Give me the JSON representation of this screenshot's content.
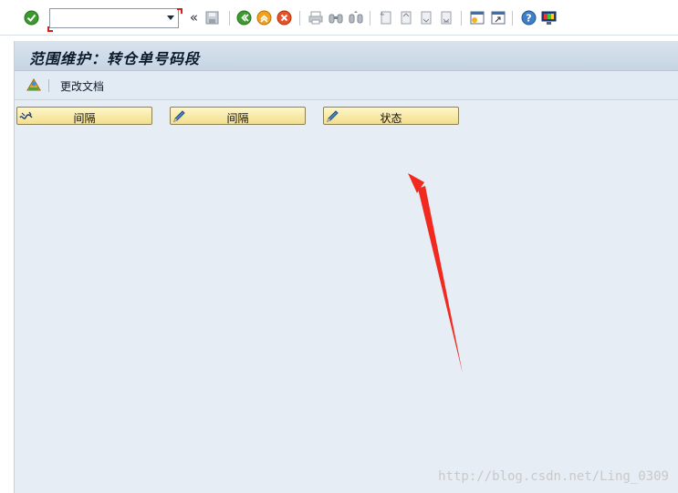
{
  "toolbar": {
    "command_field": {
      "value": "",
      "placeholder": ""
    },
    "icons": [
      "enter-icon",
      "back-double-icon",
      "save-icon",
      "back-icon",
      "exit-icon",
      "cancel-icon",
      "print-icon",
      "find-icon",
      "find-next-icon",
      "first-page-icon",
      "previous-page-icon",
      "next-page-icon",
      "last-page-icon",
      "create-session-icon",
      "shortcut-icon",
      "help-icon",
      "customize-layout-icon"
    ]
  },
  "screen": {
    "title": "范围维护：转仓单号码段"
  },
  "app_toolbar": {
    "change_docs_label": "更改文档"
  },
  "buttons": [
    {
      "label": "间隔",
      "icon": "intervals-display-icon"
    },
    {
      "label": "间隔",
      "icon": "edit-pencil-icon"
    },
    {
      "label": "状态",
      "icon": "edit-pencil-icon"
    }
  ],
  "watermark": "http://blog.csdn.net/Ling_0309",
  "colors": {
    "background": "#e6edf5",
    "title_bar": "#c6d4e3",
    "button_fill": "#f3df8d",
    "annotation_arrow": "#f02a1f"
  }
}
